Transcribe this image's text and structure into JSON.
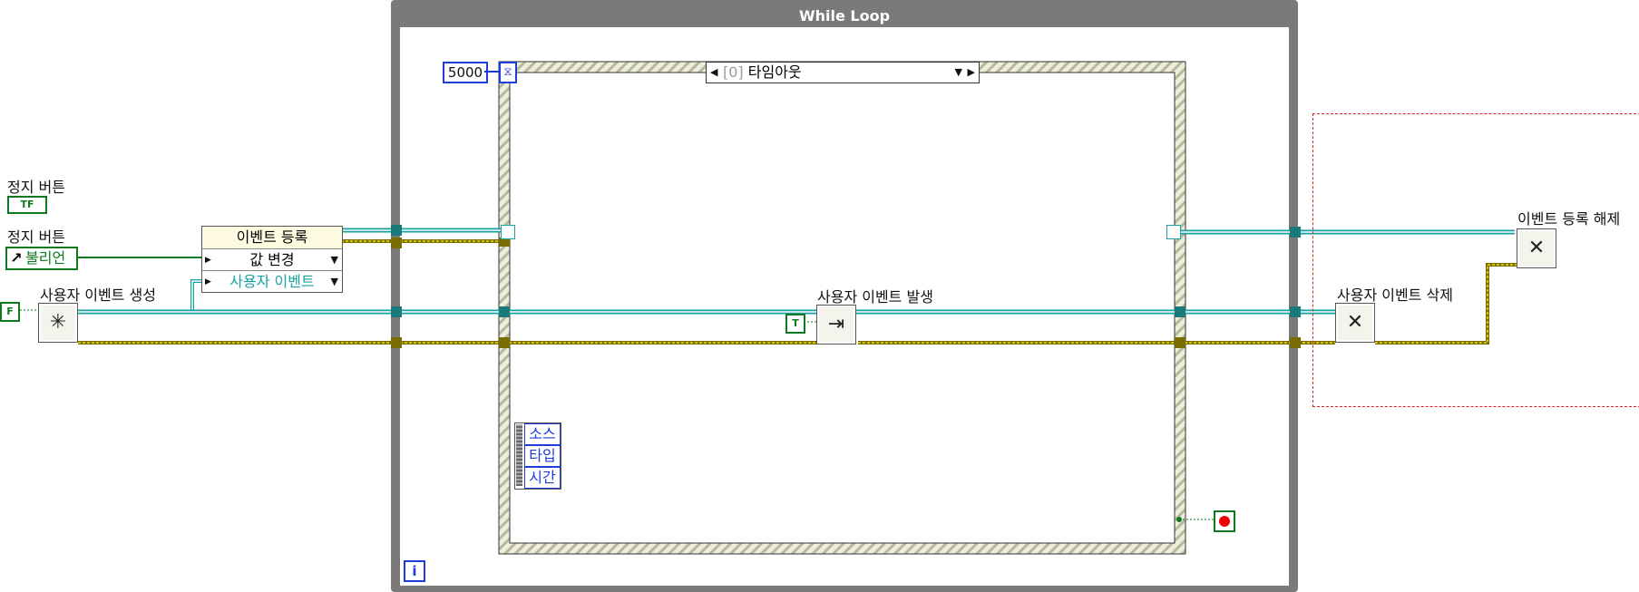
{
  "while_loop": {
    "title": "While Loop",
    "timeout_constant": "5000",
    "iteration_terminal": "i"
  },
  "event_structure": {
    "case_index": "[0]",
    "case_name": "타임아웃",
    "event_data_items": [
      "소스",
      "타입",
      "시간"
    ]
  },
  "controls": {
    "stop_button_terminal_label": "정지 버튼",
    "stop_button_terminal_text": "TF",
    "stop_button_ref_label": "정지 버튼",
    "stop_button_ref_text": "불리언",
    "false_constant": "F",
    "true_constant": "T"
  },
  "nodes": {
    "create_user_event": "사용자 이벤트 생성",
    "register_events_header": "이벤트 등록",
    "register_event_value_change": "값 변경",
    "register_event_user_event": "사용자 이벤트",
    "generate_user_event": "사용자 이벤트 발생",
    "destroy_user_event": "사용자 이벤트 삭제",
    "unregister_events": "이벤트 등록 해제"
  },
  "colors": {
    "loop_frame": "#7a7a7a",
    "refnum_wire": "#1aa0a0",
    "error_wire": "#7a6d00",
    "boolean": "#0d7a1f",
    "numeric": "#1f3cd6",
    "selection": "#e02020"
  }
}
